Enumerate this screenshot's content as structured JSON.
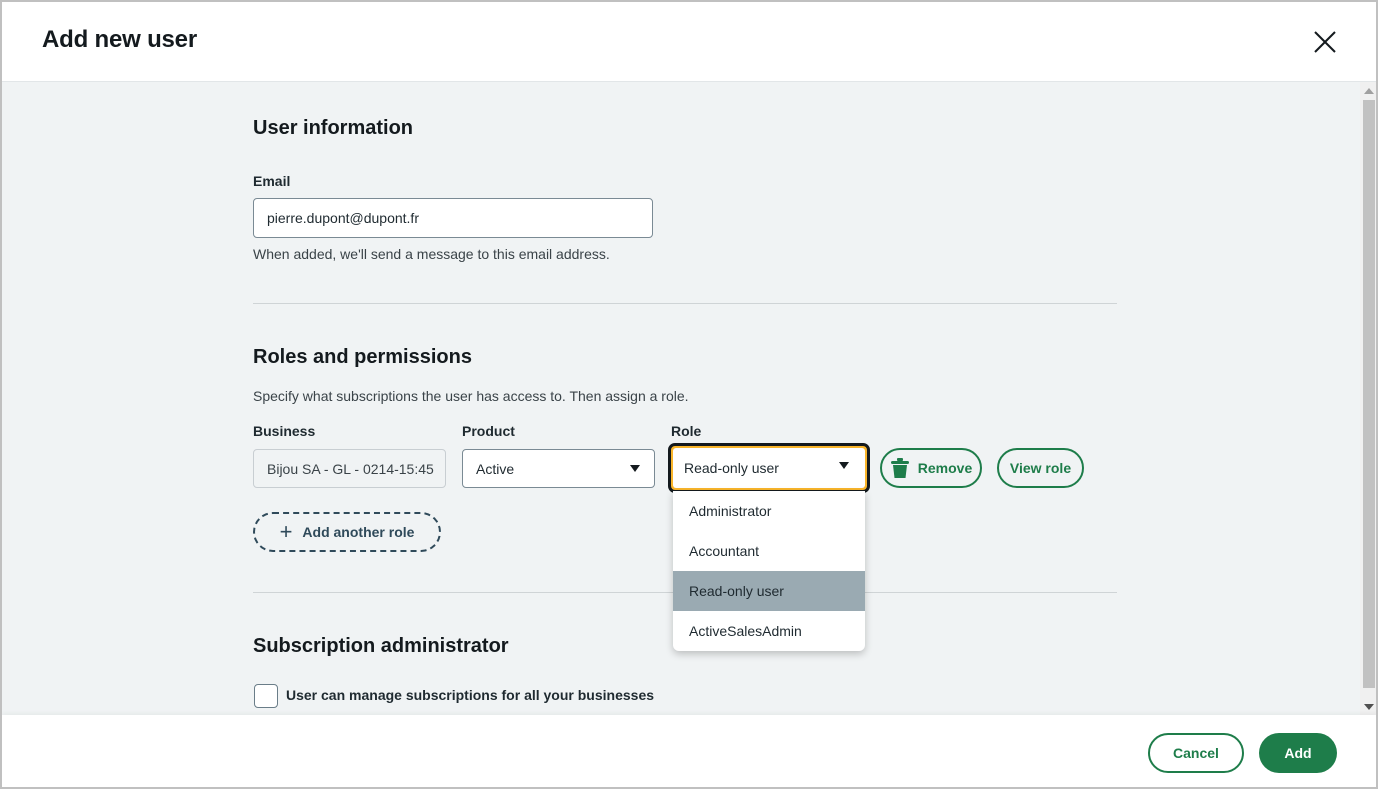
{
  "dialog": {
    "title": "Add new user",
    "close_icon": "close-icon"
  },
  "user_information": {
    "heading": "User information",
    "email_label": "Email",
    "email_value": "pierre.dupont@dupont.fr",
    "email_help": "When added, we'll send a message to this email address."
  },
  "roles": {
    "heading": "Roles and permissions",
    "description": "Specify what subscriptions the user has access to. Then assign a role.",
    "business_label": "Business",
    "business_value": "Bijou SA - GL - 0214-15:45",
    "product_label": "Product",
    "product_value": "Active",
    "role_label": "Role",
    "role_value": "Read-only user",
    "remove_label": "Remove",
    "view_role_label": "View role",
    "add_another_role_label": "Add another role",
    "role_options": [
      "Administrator",
      "Accountant",
      "Read-only user",
      "ActiveSalesAdmin"
    ],
    "selected_option": "Read-only user"
  },
  "subscription_admin": {
    "heading": "Subscription administrator",
    "checkbox_label": "User can manage subscriptions for all your businesses",
    "checked": false
  },
  "footer": {
    "cancel_label": "Cancel",
    "add_label": "Add"
  },
  "colors": {
    "brand_green": "#1e7d4a",
    "focus_ring": "#f9b52b",
    "content_bg": "#f0f3f4",
    "selected_option_bg": "#9aaab2"
  }
}
